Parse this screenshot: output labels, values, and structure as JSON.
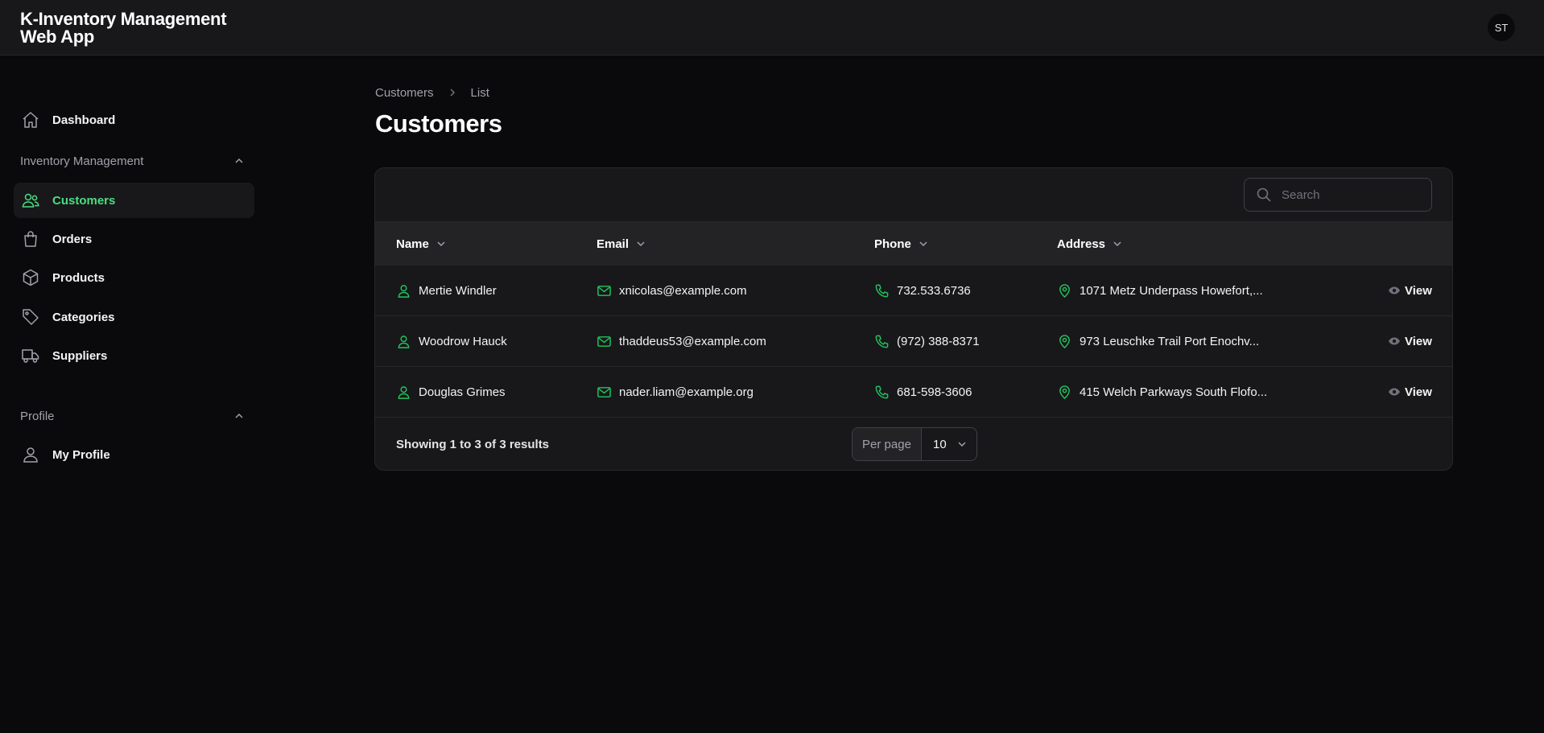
{
  "app": {
    "title": "K-Inventory Management Web App"
  },
  "user": {
    "initials": "ST"
  },
  "sidebar": {
    "dashboard": {
      "label": "Dashboard",
      "icon": "home-icon"
    },
    "groups": [
      {
        "label": "Inventory Management",
        "items": [
          {
            "label": "Customers",
            "icon": "users-icon",
            "active": true
          },
          {
            "label": "Orders",
            "icon": "shopping-bag-icon"
          },
          {
            "label": "Products",
            "icon": "cube-icon"
          },
          {
            "label": "Categories",
            "icon": "tag-icon"
          },
          {
            "label": "Suppliers",
            "icon": "truck-icon"
          }
        ]
      },
      {
        "label": "Profile",
        "items": [
          {
            "label": "My Profile",
            "icon": "user-icon"
          }
        ]
      }
    ]
  },
  "breadcrumb": {
    "items": [
      "Customers",
      "List"
    ]
  },
  "page": {
    "title": "Customers"
  },
  "search": {
    "placeholder": "Search",
    "value": ""
  },
  "table": {
    "columns": [
      "Name",
      "Email",
      "Phone",
      "Address"
    ],
    "rows": [
      {
        "name": "Mertie Windler",
        "email": "xnicolas@example.com",
        "phone": "732.533.6736",
        "address": "1071 Metz Underpass Howefort,...",
        "action": "View"
      },
      {
        "name": "Woodrow Hauck",
        "email": "thaddeus53@example.com",
        "phone": "(972) 388-8371",
        "address": "973 Leuschke Trail Port Enochv...",
        "action": "View"
      },
      {
        "name": "Douglas Grimes",
        "email": "nader.liam@example.org",
        "phone": "681-598-3606",
        "address": "415 Welch Parkways South Flofo...",
        "action": "View"
      }
    ]
  },
  "pagination": {
    "results_text": "Showing 1 to 3 of 3 results",
    "per_page_label": "Per page",
    "per_page_value": "10"
  },
  "colors": {
    "accent": "#4ade80",
    "background": "#0a0a0c",
    "surface": "#18181b"
  }
}
